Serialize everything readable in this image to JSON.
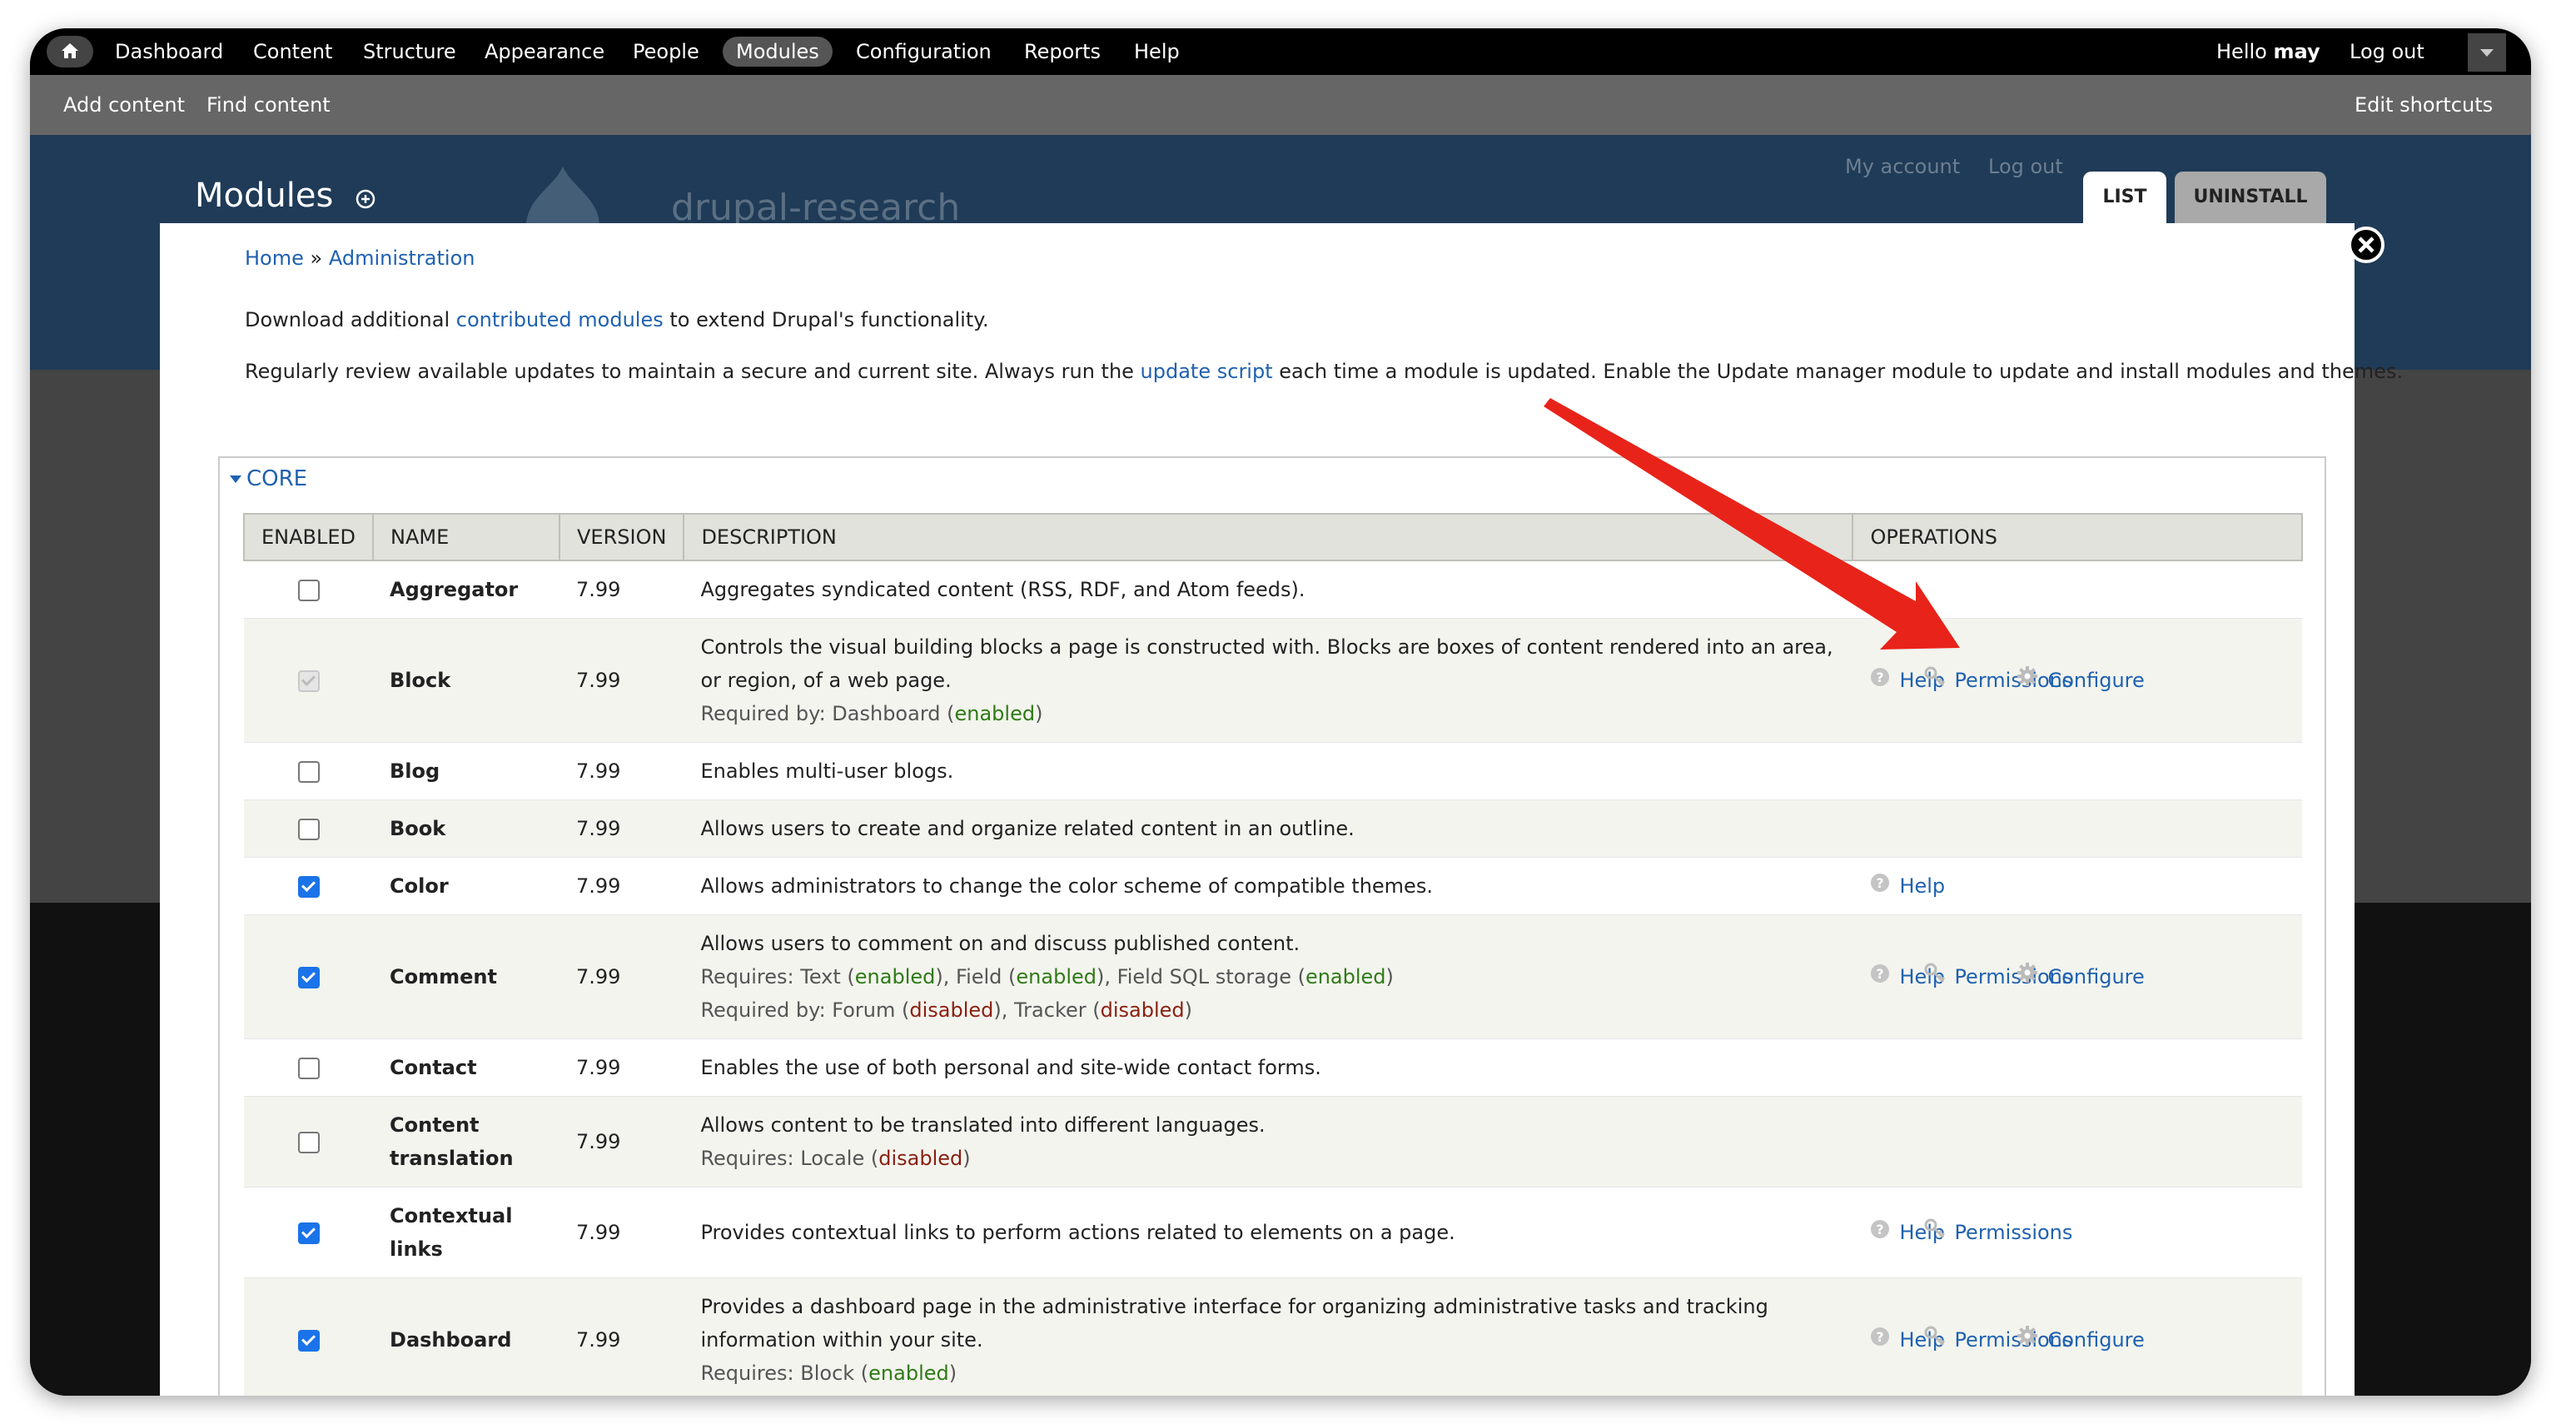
{
  "toolbar": {
    "menu": [
      "Dashboard",
      "Content",
      "Structure",
      "Appearance",
      "People",
      "Modules",
      "Configuration",
      "Reports",
      "Help"
    ],
    "active_item": "Modules",
    "greeting_prefix": "Hello",
    "username": "may",
    "logout": "Log out"
  },
  "shortcuts": {
    "items": [
      "Add content",
      "Find content"
    ],
    "edit": "Edit shortcuts"
  },
  "site": {
    "name": "drupal-research",
    "secondary_links": [
      "My account",
      "Log out"
    ]
  },
  "overlay": {
    "title": "Modules",
    "tabs": [
      "LIST",
      "UNINSTALL"
    ]
  },
  "breadcrumb": [
    "Home",
    "Administration"
  ],
  "breadcrumb_sep": "»",
  "intro": {
    "p1": {
      "before": "Download additional ",
      "link": "contributed modules",
      "after": " to extend Drupal's functionality."
    },
    "p2": {
      "before": "Regularly review available updates to maintain a secure and current site. Always run the ",
      "link": "update script",
      "after": " each time a module is updated. Enable the Update manager module to update and install modules and themes."
    }
  },
  "fieldset": {
    "legend": "CORE"
  },
  "table": {
    "headers": [
      "ENABLED",
      "NAME",
      "VERSION",
      "DESCRIPTION",
      "OPERATIONS"
    ],
    "op_labels": {
      "help": "Help",
      "permissions": "Permissions",
      "configure": "Configure"
    },
    "status": {
      "enabled": "enabled",
      "disabled": "disabled"
    },
    "rows": [
      {
        "name": "Aggregator",
        "version": "7.99",
        "checked": false,
        "disabled": false,
        "desc": [
          "Aggregates syndicated content (RSS, RDF, and Atom feeds)."
        ],
        "ops": []
      },
      {
        "name": "Block",
        "version": "7.99",
        "checked": true,
        "disabled": true,
        "desc": [
          "Controls the visual building blocks a page is constructed with. Blocks are boxes of content rendered into an area,",
          "or region, of a web page."
        ],
        "reqby": [
          {
            "label": "Required by: ",
            "items": [
              {
                "name": "Dashboard",
                "status": "enabled"
              }
            ]
          }
        ],
        "ops": [
          "help",
          "permissions",
          "configure"
        ]
      },
      {
        "name": "Blog",
        "version": "7.99",
        "checked": false,
        "disabled": false,
        "desc": [
          "Enables multi-user blogs."
        ],
        "ops": []
      },
      {
        "name": "Book",
        "version": "7.99",
        "checked": false,
        "disabled": false,
        "desc": [
          "Allows users to create and organize related content in an outline."
        ],
        "ops": []
      },
      {
        "name": "Color",
        "version": "7.99",
        "checked": true,
        "disabled": false,
        "desc": [
          "Allows administrators to change the color scheme of compatible themes."
        ],
        "ops": [
          "help"
        ]
      },
      {
        "name": "Comment",
        "version": "7.99",
        "checked": true,
        "disabled": false,
        "desc": [
          "Allows users to comment on and discuss published content."
        ],
        "reqby": [
          {
            "label": "Requires: ",
            "items": [
              {
                "name": "Text",
                "status": "enabled"
              },
              {
                "name": "Field",
                "status": "enabled"
              },
              {
                "name": "Field SQL storage",
                "status": "enabled"
              }
            ]
          },
          {
            "label": "Required by: ",
            "items": [
              {
                "name": "Forum",
                "status": "disabled"
              },
              {
                "name": "Tracker",
                "status": "disabled"
              }
            ]
          }
        ],
        "ops": [
          "help",
          "permissions",
          "configure"
        ]
      },
      {
        "name": "Contact",
        "version": "7.99",
        "checked": false,
        "disabled": false,
        "desc": [
          "Enables the use of both personal and site-wide contact forms."
        ],
        "ops": []
      },
      {
        "name": "Content translation",
        "name_lines": [
          "Content",
          "translation"
        ],
        "version": "7.99",
        "checked": false,
        "disabled": false,
        "desc": [
          "Allows content to be translated into different languages."
        ],
        "reqby": [
          {
            "label": "Requires: ",
            "items": [
              {
                "name": "Locale",
                "status": "disabled"
              }
            ]
          }
        ],
        "ops": []
      },
      {
        "name": "Contextual links",
        "name_lines": [
          "Contextual",
          "links"
        ],
        "version": "7.99",
        "checked": true,
        "disabled": false,
        "desc": [
          "Provides contextual links to perform actions related to elements on a page."
        ],
        "ops": [
          "help",
          "permissions"
        ]
      },
      {
        "name": "Dashboard",
        "version": "7.99",
        "checked": true,
        "disabled": false,
        "desc": [
          "Provides a dashboard page in the administrative interface for organizing administrative tasks and tracking",
          "information within your site."
        ],
        "reqby": [
          {
            "label": "Requires: ",
            "items": [
              {
                "name": "Block",
                "status": "enabled"
              }
            ]
          }
        ],
        "ops": [
          "help",
          "permissions",
          "configure"
        ]
      }
    ]
  },
  "colors": {
    "link": "#1f61b0",
    "arrow": "#e8231a",
    "enabled": "#2f7a16",
    "disabled": "#8a1f11",
    "header_bg": "#1f3b57"
  },
  "icons": {
    "home": "home-icon",
    "close": "close-icon",
    "help": "help-circle-icon",
    "permissions": "key-icon",
    "configure": "gear-icon",
    "add": "plus-circle-icon"
  }
}
